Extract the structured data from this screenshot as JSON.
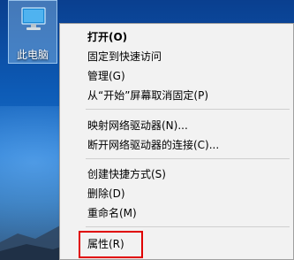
{
  "desktop": {
    "icon_label": "此电脑"
  },
  "context_menu": {
    "items": [
      {
        "label": "打开(O)"
      },
      {
        "label": "固定到快速访问"
      },
      {
        "label": "管理(G)"
      },
      {
        "label": "从“开始”屏幕取消固定(P)"
      },
      {
        "label": "映射网络驱动器(N)..."
      },
      {
        "label": "断开网络驱动器的连接(C)..."
      },
      {
        "label": "创建快捷方式(S)"
      },
      {
        "label": "删除(D)"
      },
      {
        "label": "重命名(M)"
      },
      {
        "label": "属性(R)"
      }
    ]
  },
  "colors": {
    "highlight_border": "#e00000",
    "menu_background": "#f2f2f2"
  }
}
